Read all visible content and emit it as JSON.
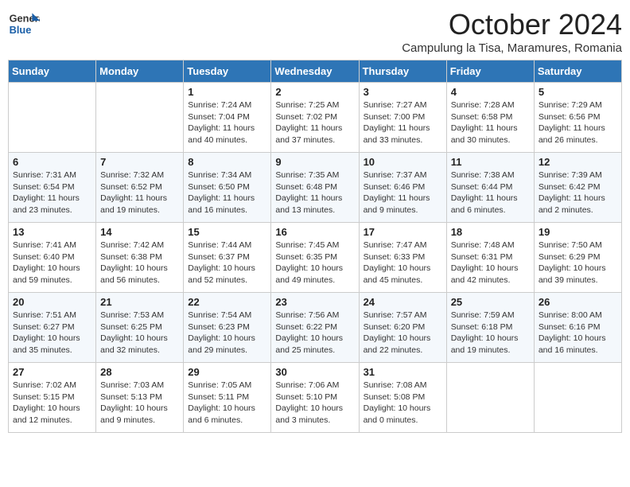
{
  "header": {
    "logo_general": "General",
    "logo_blue": "Blue",
    "month": "October 2024",
    "location": "Campulung la Tisa, Maramures, Romania"
  },
  "days_of_week": [
    "Sunday",
    "Monday",
    "Tuesday",
    "Wednesday",
    "Thursday",
    "Friday",
    "Saturday"
  ],
  "weeks": [
    [
      {
        "day": "",
        "info": ""
      },
      {
        "day": "",
        "info": ""
      },
      {
        "day": "1",
        "info": "Sunrise: 7:24 AM\nSunset: 7:04 PM\nDaylight: 11 hours and 40 minutes."
      },
      {
        "day": "2",
        "info": "Sunrise: 7:25 AM\nSunset: 7:02 PM\nDaylight: 11 hours and 37 minutes."
      },
      {
        "day": "3",
        "info": "Sunrise: 7:27 AM\nSunset: 7:00 PM\nDaylight: 11 hours and 33 minutes."
      },
      {
        "day": "4",
        "info": "Sunrise: 7:28 AM\nSunset: 6:58 PM\nDaylight: 11 hours and 30 minutes."
      },
      {
        "day": "5",
        "info": "Sunrise: 7:29 AM\nSunset: 6:56 PM\nDaylight: 11 hours and 26 minutes."
      }
    ],
    [
      {
        "day": "6",
        "info": "Sunrise: 7:31 AM\nSunset: 6:54 PM\nDaylight: 11 hours and 23 minutes."
      },
      {
        "day": "7",
        "info": "Sunrise: 7:32 AM\nSunset: 6:52 PM\nDaylight: 11 hours and 19 minutes."
      },
      {
        "day": "8",
        "info": "Sunrise: 7:34 AM\nSunset: 6:50 PM\nDaylight: 11 hours and 16 minutes."
      },
      {
        "day": "9",
        "info": "Sunrise: 7:35 AM\nSunset: 6:48 PM\nDaylight: 11 hours and 13 minutes."
      },
      {
        "day": "10",
        "info": "Sunrise: 7:37 AM\nSunset: 6:46 PM\nDaylight: 11 hours and 9 minutes."
      },
      {
        "day": "11",
        "info": "Sunrise: 7:38 AM\nSunset: 6:44 PM\nDaylight: 11 hours and 6 minutes."
      },
      {
        "day": "12",
        "info": "Sunrise: 7:39 AM\nSunset: 6:42 PM\nDaylight: 11 hours and 2 minutes."
      }
    ],
    [
      {
        "day": "13",
        "info": "Sunrise: 7:41 AM\nSunset: 6:40 PM\nDaylight: 10 hours and 59 minutes."
      },
      {
        "day": "14",
        "info": "Sunrise: 7:42 AM\nSunset: 6:38 PM\nDaylight: 10 hours and 56 minutes."
      },
      {
        "day": "15",
        "info": "Sunrise: 7:44 AM\nSunset: 6:37 PM\nDaylight: 10 hours and 52 minutes."
      },
      {
        "day": "16",
        "info": "Sunrise: 7:45 AM\nSunset: 6:35 PM\nDaylight: 10 hours and 49 minutes."
      },
      {
        "day": "17",
        "info": "Sunrise: 7:47 AM\nSunset: 6:33 PM\nDaylight: 10 hours and 45 minutes."
      },
      {
        "day": "18",
        "info": "Sunrise: 7:48 AM\nSunset: 6:31 PM\nDaylight: 10 hours and 42 minutes."
      },
      {
        "day": "19",
        "info": "Sunrise: 7:50 AM\nSunset: 6:29 PM\nDaylight: 10 hours and 39 minutes."
      }
    ],
    [
      {
        "day": "20",
        "info": "Sunrise: 7:51 AM\nSunset: 6:27 PM\nDaylight: 10 hours and 35 minutes."
      },
      {
        "day": "21",
        "info": "Sunrise: 7:53 AM\nSunset: 6:25 PM\nDaylight: 10 hours and 32 minutes."
      },
      {
        "day": "22",
        "info": "Sunrise: 7:54 AM\nSunset: 6:23 PM\nDaylight: 10 hours and 29 minutes."
      },
      {
        "day": "23",
        "info": "Sunrise: 7:56 AM\nSunset: 6:22 PM\nDaylight: 10 hours and 25 minutes."
      },
      {
        "day": "24",
        "info": "Sunrise: 7:57 AM\nSunset: 6:20 PM\nDaylight: 10 hours and 22 minutes."
      },
      {
        "day": "25",
        "info": "Sunrise: 7:59 AM\nSunset: 6:18 PM\nDaylight: 10 hours and 19 minutes."
      },
      {
        "day": "26",
        "info": "Sunrise: 8:00 AM\nSunset: 6:16 PM\nDaylight: 10 hours and 16 minutes."
      }
    ],
    [
      {
        "day": "27",
        "info": "Sunrise: 7:02 AM\nSunset: 5:15 PM\nDaylight: 10 hours and 12 minutes."
      },
      {
        "day": "28",
        "info": "Sunrise: 7:03 AM\nSunset: 5:13 PM\nDaylight: 10 hours and 9 minutes."
      },
      {
        "day": "29",
        "info": "Sunrise: 7:05 AM\nSunset: 5:11 PM\nDaylight: 10 hours and 6 minutes."
      },
      {
        "day": "30",
        "info": "Sunrise: 7:06 AM\nSunset: 5:10 PM\nDaylight: 10 hours and 3 minutes."
      },
      {
        "day": "31",
        "info": "Sunrise: 7:08 AM\nSunset: 5:08 PM\nDaylight: 10 hours and 0 minutes."
      },
      {
        "day": "",
        "info": ""
      },
      {
        "day": "",
        "info": ""
      }
    ]
  ]
}
